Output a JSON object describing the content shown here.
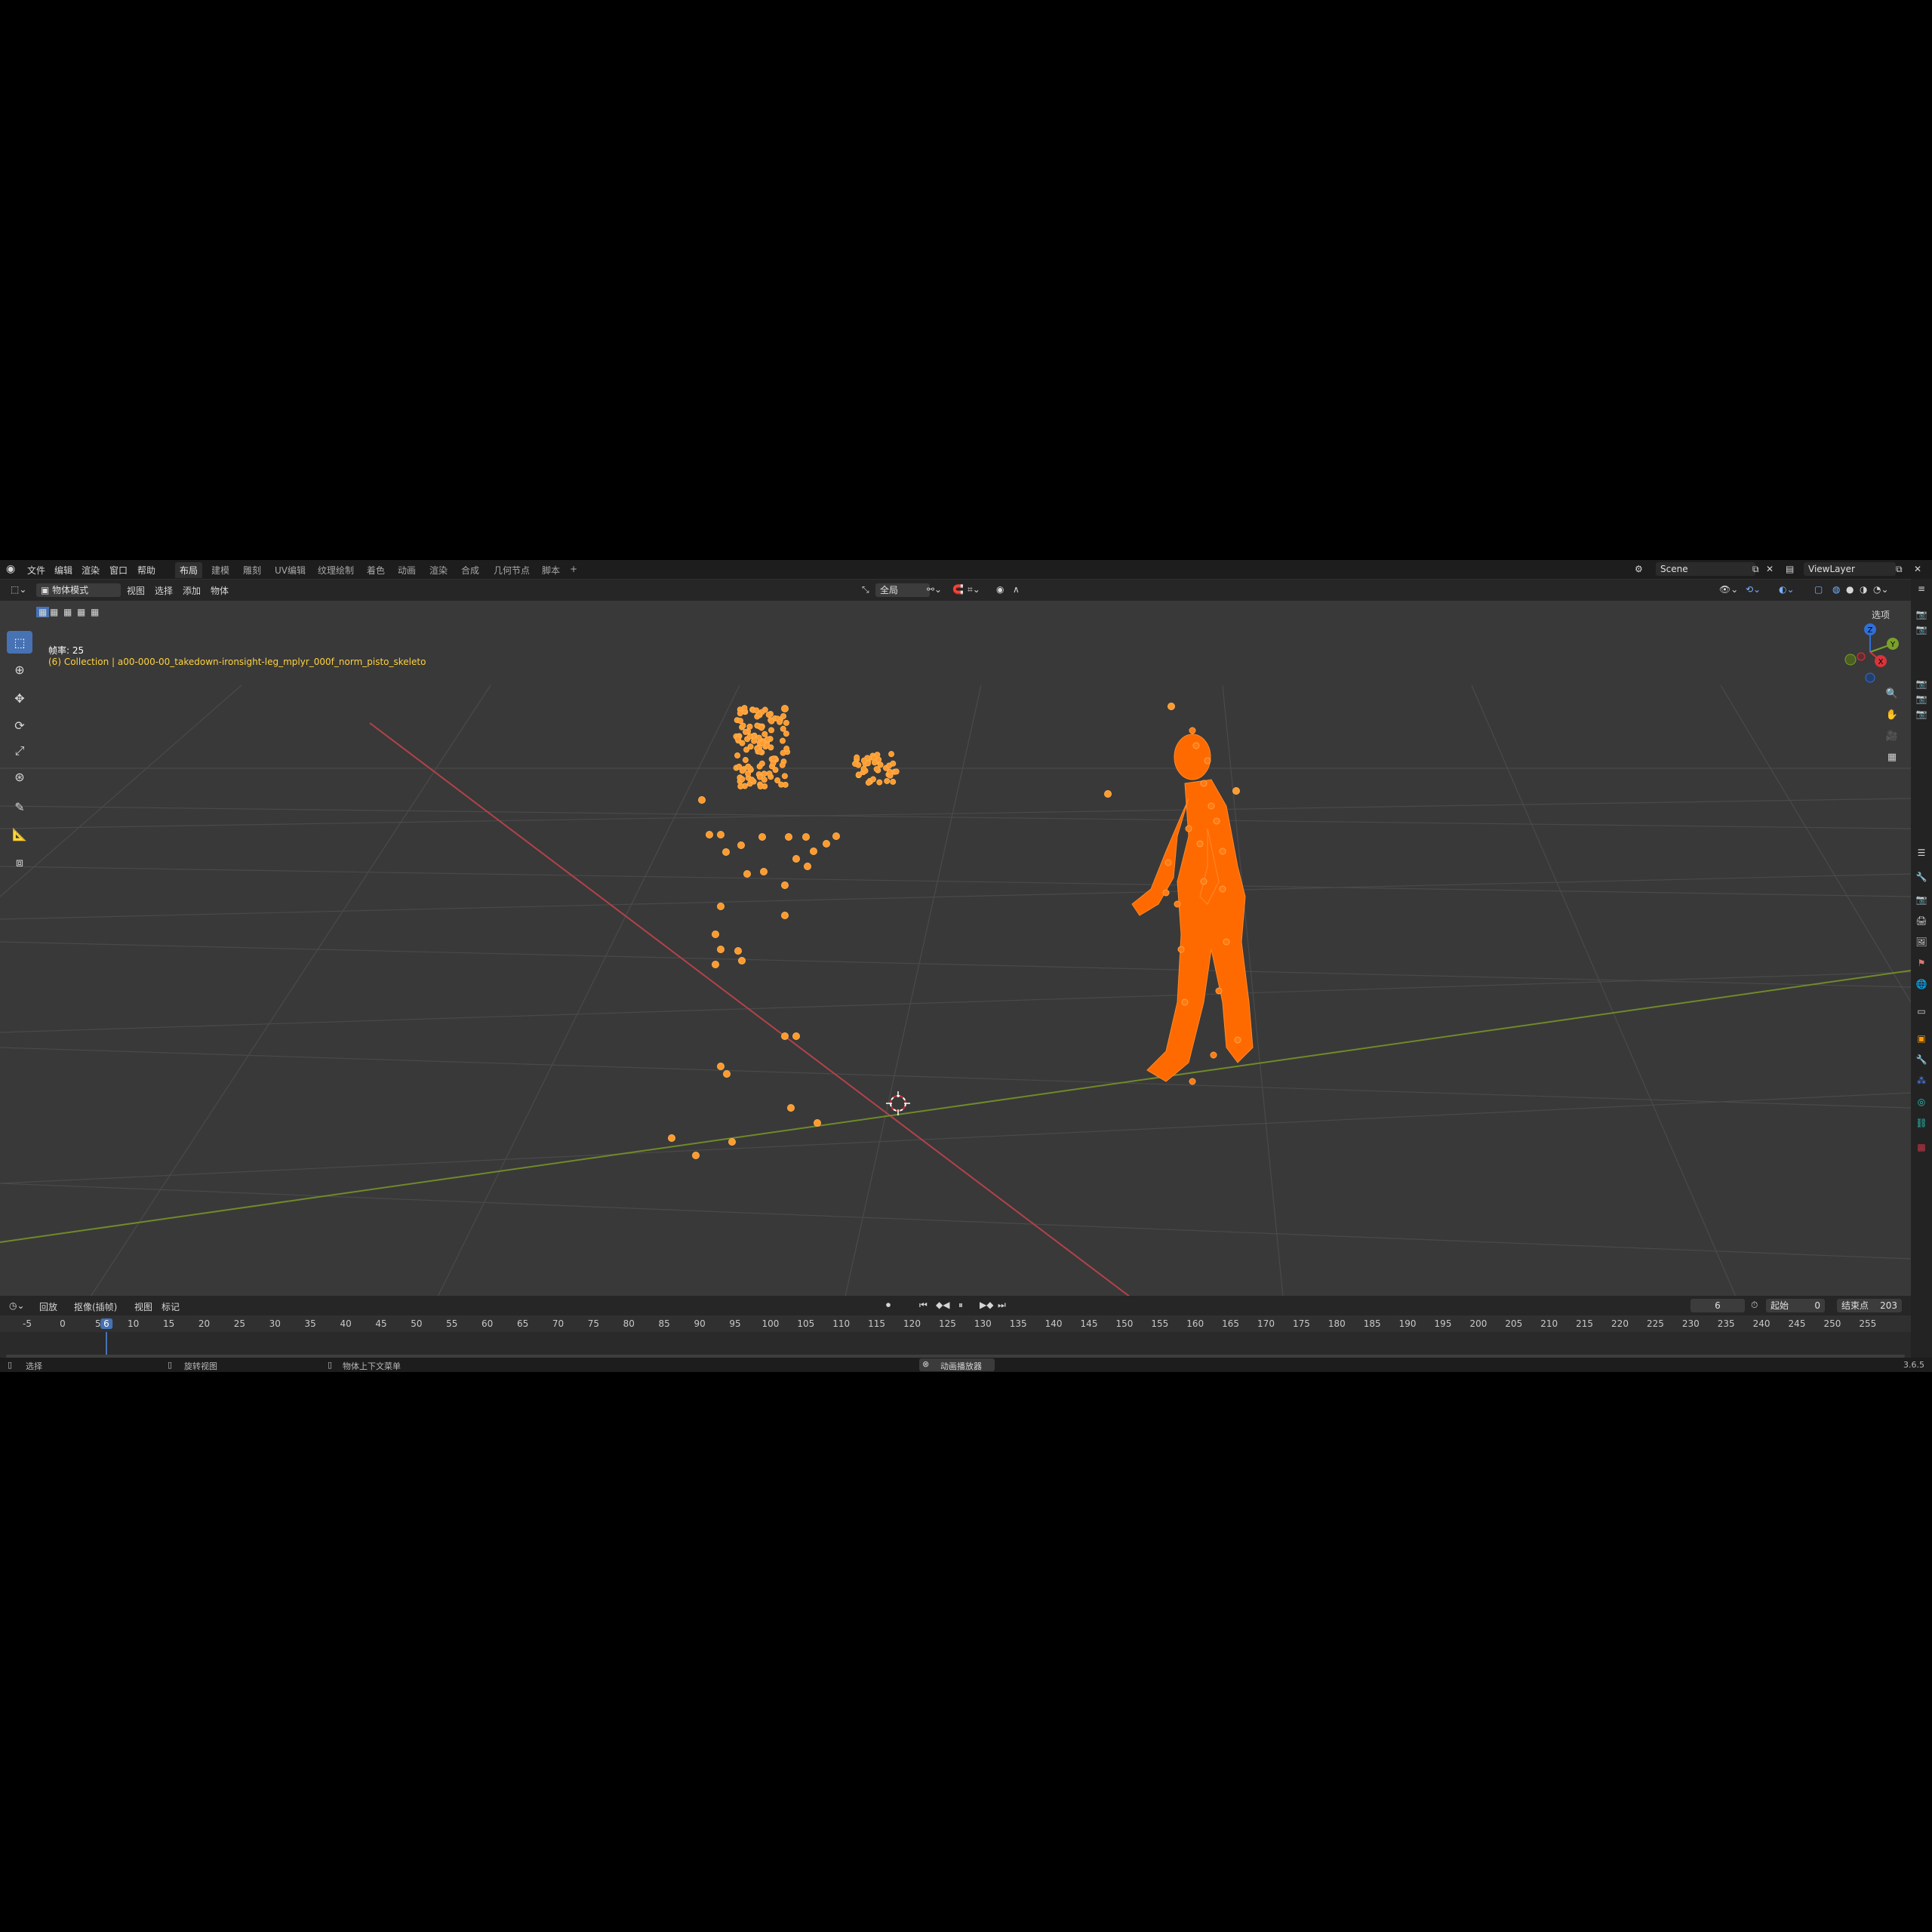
{
  "topbar": {
    "logo_icon": "blender-icon",
    "menus": [
      "文件",
      "编辑",
      "渲染",
      "窗口",
      "帮助"
    ],
    "workspaces": [
      "布局",
      "建模",
      "雕刻",
      "UV编辑",
      "纹理绘制",
      "着色",
      "动画",
      "渲染",
      "合成",
      "几何节点",
      "脚本"
    ],
    "active_workspace": "布局",
    "add_tab": "+",
    "scene": "Scene",
    "view_layer": "ViewLayer"
  },
  "header": {
    "mode": "物体模式",
    "menus": [
      "视图",
      "选择",
      "添加",
      "物体"
    ],
    "transform_orientation": "全局",
    "options": "选项"
  },
  "viewport": {
    "fps": "帧率: 25",
    "object_info": "(6) Collection | a00-000-00_takedown-ironsight-leg_mplyr_000f_norm_pisto_skeleto",
    "accent": "#ff6a00",
    "point_color": "#ff9a2e"
  },
  "toolbar": {
    "tools": [
      "select-box-icon",
      "cursor-icon",
      "move-icon",
      "rotate-icon",
      "scale-icon",
      "transform-icon",
      "annotate-icon",
      "measure-icon",
      "add-cube-icon"
    ]
  },
  "navigation": {
    "gizmo": {
      "x": "X",
      "y": "Y",
      "z": "Z"
    },
    "buttons": [
      "zoom-icon",
      "hand-icon",
      "camera-icon",
      "grid-icon"
    ]
  },
  "timeline": {
    "playback": "回放",
    "keying": "抠像(插帧)",
    "view": "视图",
    "marker": "标记",
    "current_frame": "6",
    "start_label": "起始",
    "start": "0",
    "end_label": "结束点",
    "end": "203",
    "ticks": [
      "-5",
      "0",
      "5",
      "10",
      "15",
      "20",
      "25",
      "30",
      "35",
      "40",
      "45",
      "50",
      "55",
      "60",
      "65",
      "70",
      "75",
      "80",
      "85",
      "90",
      "95",
      "100",
      "105",
      "110",
      "115",
      "120",
      "125",
      "130",
      "135",
      "140",
      "145",
      "150",
      "155",
      "160",
      "165",
      "170",
      "175",
      "180",
      "185",
      "190",
      "195",
      "200",
      "205",
      "210",
      "215",
      "220",
      "225",
      "230",
      "235",
      "240",
      "245",
      "250",
      "255"
    ]
  },
  "status": {
    "select": "选择",
    "rotate_view": "旋转视图",
    "context_menu": "物体上下文菜单",
    "playing": "动画播放器",
    "version": "3.6.5"
  }
}
